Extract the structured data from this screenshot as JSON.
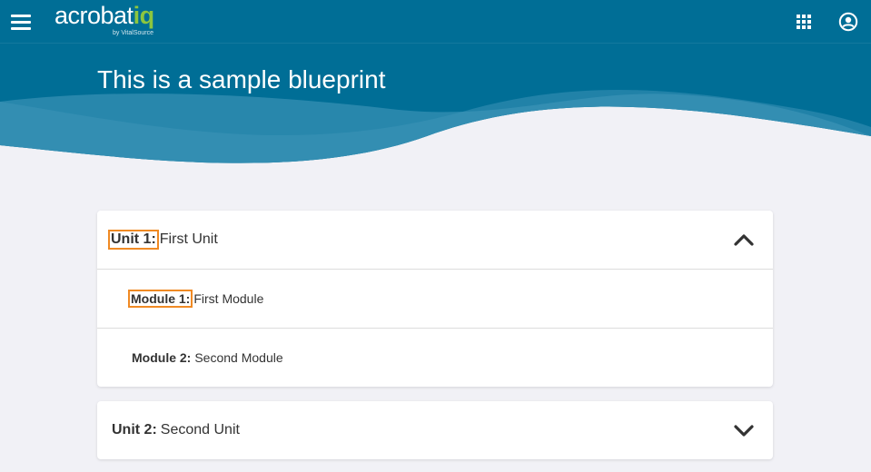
{
  "header": {
    "logo_text": "acrobat",
    "logo_accent": "iq",
    "logo_sub": "by VitalSource",
    "page_title": "This is a sample blueprint"
  },
  "colors": {
    "header_bg": "#006e96",
    "wave_light": "#2a88ad",
    "page_bg": "#f1f1f6",
    "highlight": "#f08a24",
    "logo_accent": "#8cc63f"
  },
  "icons": {
    "menu": "hamburger-menu-icon",
    "apps": "apps-grid-icon",
    "account": "account-circle-icon",
    "expanded": "chevron-up-icon",
    "collapsed": "chevron-down-icon"
  },
  "units": [
    {
      "label": "Unit 1:",
      "title": "First Unit",
      "expanded": true,
      "modules": [
        {
          "label": "Module 1:",
          "title": "First Module"
        },
        {
          "label": "Module 2:",
          "title": "Second Module"
        }
      ]
    },
    {
      "label": "Unit 2:",
      "title": "Second Unit",
      "expanded": false
    }
  ]
}
